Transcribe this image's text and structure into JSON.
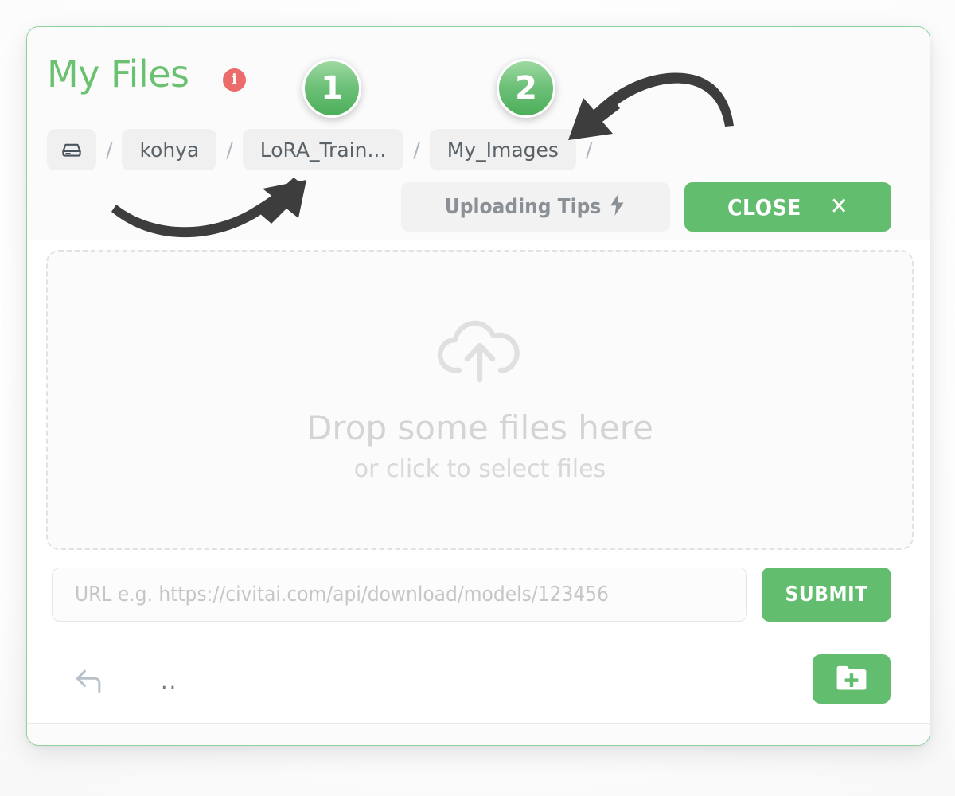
{
  "window": {
    "title": "My Files",
    "info_icon": "info-icon",
    "accent_green": "#62bd6e",
    "title_green": "#6ac16f",
    "info_red": "#ec6b6b"
  },
  "breadcrumb": {
    "root_icon": "hard-drive-icon",
    "separator": "/",
    "items": [
      {
        "label": "kohya"
      },
      {
        "label": "LoRA_Train..."
      },
      {
        "label": "My_Images"
      }
    ],
    "trailing_separator": "/"
  },
  "actions": {
    "tips_label": "Uploading Tips",
    "tips_icon": "lightning-bolt-icon",
    "close_label": "CLOSE",
    "close_icon": "close-x-icon"
  },
  "dropzone": {
    "icon": "cloud-upload-icon",
    "primary_text": "Drop some files here",
    "secondary_text": "or click to select files"
  },
  "url_row": {
    "placeholder": "URL e.g. https://civitai.com/api/download/models/123456",
    "value": "",
    "submit_label": "SUBMIT"
  },
  "file_list": {
    "back_icon": "back-arrow-icon",
    "parent_label": "..",
    "new_folder_icon": "folder-plus-icon"
  },
  "annotations": {
    "steps": [
      {
        "number": "1",
        "target": "LoRA_Train... breadcrumb"
      },
      {
        "number": "2",
        "target": "My_Images breadcrumb"
      }
    ],
    "arrows": [
      {
        "name": "arrow-to-step-1",
        "direction": "up-right"
      },
      {
        "name": "arrow-to-step-2",
        "direction": "down-left"
      }
    ]
  }
}
